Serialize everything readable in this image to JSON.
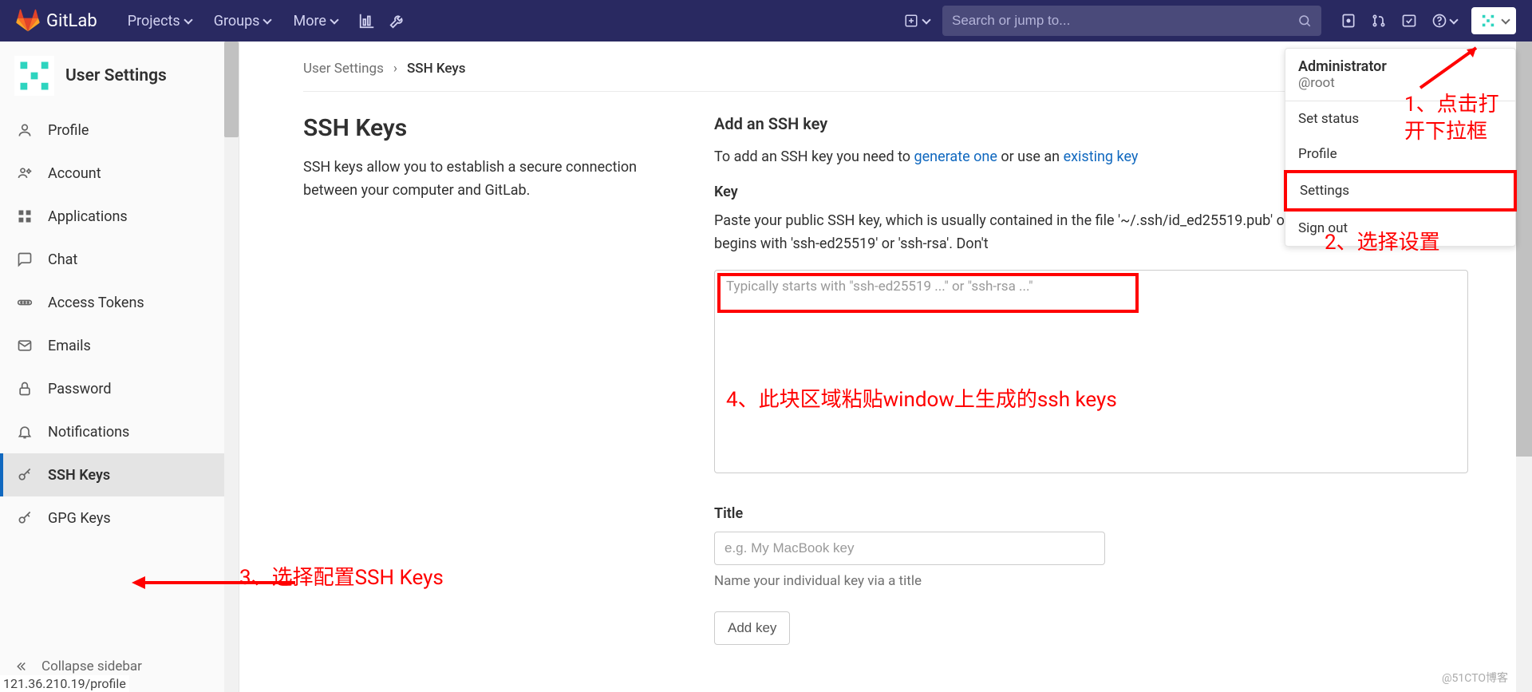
{
  "brand": "GitLab",
  "nav": {
    "projects": "Projects",
    "groups": "Groups",
    "more": "More",
    "search_placeholder": "Search or jump to..."
  },
  "user_menu": {
    "name": "Administrator",
    "handle": "@root",
    "set_status": "Set status",
    "profile": "Profile",
    "settings": "Settings",
    "sign_out": "Sign out"
  },
  "sidebar": {
    "title": "User Settings",
    "items": [
      {
        "label": "Profile"
      },
      {
        "label": "Account"
      },
      {
        "label": "Applications"
      },
      {
        "label": "Chat"
      },
      {
        "label": "Access Tokens"
      },
      {
        "label": "Emails"
      },
      {
        "label": "Password"
      },
      {
        "label": "Notifications"
      },
      {
        "label": "SSH Keys"
      },
      {
        "label": "GPG Keys"
      }
    ],
    "collapse": "Collapse sidebar"
  },
  "breadcrumb": {
    "parent": "User Settings",
    "current": "SSH Keys"
  },
  "content": {
    "heading": "SSH Keys",
    "desc": "SSH keys allow you to establish a secure connection between your computer and GitLab.",
    "add_heading": "Add an SSH key",
    "add_intro_pre": "To add an SSH key you need to ",
    "generate": "generate one",
    "add_intro_mid": " or use an ",
    "existing": "existing key",
    "key_label": "Key",
    "key_help": "Paste your public SSH key, which is usually contained in the file '~/.ssh/id_ed25519.pub' or '~/.ssh/id_rsa.pub' and begins with 'ssh-ed25519' or 'ssh-rsa'. Don't",
    "key_placeholder": "Typically starts with \"ssh-ed25519 ...\" or \"ssh-rsa ...\"",
    "title_label": "Title",
    "title_placeholder": "e.g. My MacBook key",
    "title_hint": "Name your individual key via a title",
    "add_button": "Add key"
  },
  "annotations": {
    "a1": "1、点击打开下拉框",
    "a2": "2、选择设置",
    "a3": "3、选择配置SSH Keys",
    "a4": "4、此块区域粘贴window上生成的ssh keys"
  },
  "status_url": "121.36.210.19/profile",
  "watermark": "@51CTO博客"
}
